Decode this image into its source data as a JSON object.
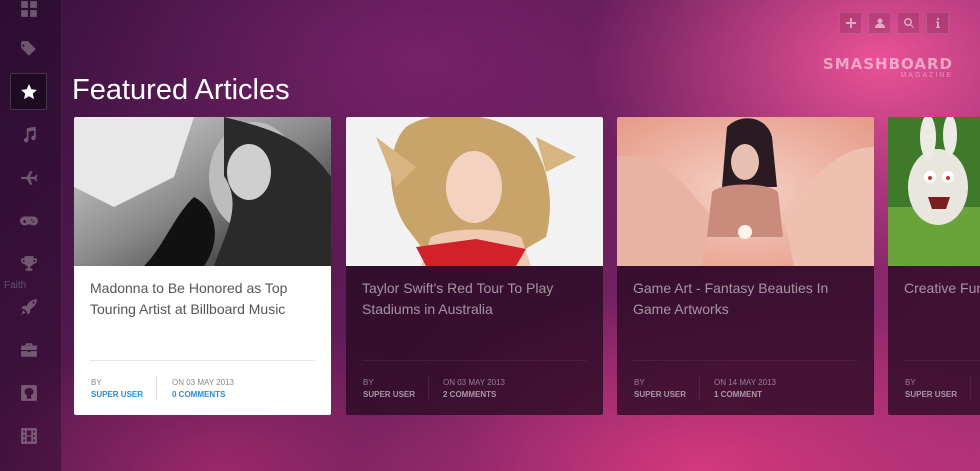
{
  "page": {
    "title": "Featured Articles"
  },
  "logo": {
    "name": "SMASHBOARD",
    "tagline": "MAGAZINE"
  },
  "sidebar": {
    "items": [
      {
        "name": "grid-icon",
        "active": false
      },
      {
        "name": "tags-icon",
        "active": false
      },
      {
        "name": "star-icon",
        "active": true
      },
      {
        "name": "music-icon",
        "active": false
      },
      {
        "name": "plane-icon",
        "active": false
      },
      {
        "name": "gamepad-icon",
        "active": false
      },
      {
        "name": "trophy-icon",
        "active": false
      },
      {
        "name": "rocket-icon",
        "active": false
      },
      {
        "name": "briefcase-icon",
        "active": false
      },
      {
        "name": "github-icon",
        "active": false
      },
      {
        "name": "film-icon",
        "active": false
      }
    ],
    "faded_label": "Faith"
  },
  "top_buttons": [
    {
      "name": "plus-icon"
    },
    {
      "name": "user-icon"
    },
    {
      "name": "search-icon"
    },
    {
      "name": "info-icon"
    }
  ],
  "articles": [
    {
      "title": "Madonna to Be Honored as Top Touring Artist at Billboard Music",
      "by_label": "BY",
      "author": "SUPER USER",
      "date": "ON 03 MAY 2013",
      "comments": "0 COMMENTS",
      "image": "black-and-white-portrait",
      "style": "light"
    },
    {
      "title": "Taylor Swift's Red Tour To Play Stadiums in Australia",
      "by_label": "BY",
      "author": "SUPER USER",
      "date": "ON 03 MAY 2013",
      "comments": "2 COMMENTS",
      "image": "blonde-portrait",
      "style": "dark"
    },
    {
      "title": "Game Art - Fantasy Beauties In Game Artworks",
      "by_label": "BY",
      "author": "SUPER USER",
      "date": "ON 14 MAY 2013",
      "comments": "1 COMMENT",
      "image": "fantasy-artwork",
      "style": "dark"
    },
    {
      "title": "Creative Fun",
      "by_label": "BY",
      "author": "SUPER USER",
      "date": "",
      "comments": "",
      "image": "cartoon-rabbit",
      "style": "dark"
    }
  ]
}
